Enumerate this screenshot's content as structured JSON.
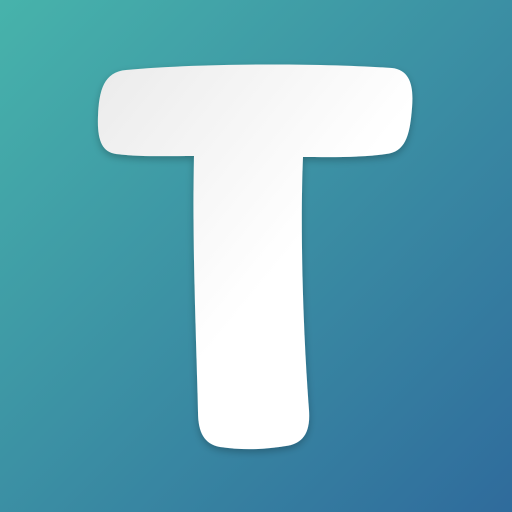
{
  "icon": {
    "letter": "T",
    "background_colors": [
      "#47b3ab",
      "#2f6b9c"
    ],
    "glyph_colors": [
      "#ebebeb",
      "#ffffff"
    ]
  }
}
